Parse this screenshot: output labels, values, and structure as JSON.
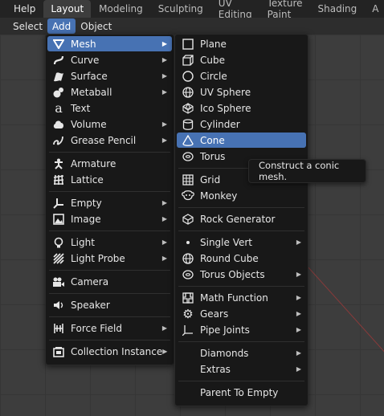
{
  "topbar": {
    "help": "Help",
    "tabs": [
      {
        "label": "Layout",
        "active": true
      },
      {
        "label": "Modeling"
      },
      {
        "label": "Sculpting"
      },
      {
        "label": "UV Editing"
      },
      {
        "label": "Texture Paint"
      },
      {
        "label": "Shading"
      },
      {
        "label": "A"
      }
    ]
  },
  "header": {
    "items": [
      {
        "label": "Select"
      },
      {
        "label": "Add",
        "active": true
      },
      {
        "label": "Object"
      }
    ]
  },
  "add_menu": {
    "items": [
      {
        "label": "Mesh",
        "icon": "mesh-icon",
        "submenu": true,
        "highlighted": true
      },
      {
        "label": "Curve",
        "icon": "curve-icon",
        "submenu": true
      },
      {
        "label": "Surface",
        "icon": "surface-icon",
        "submenu": true
      },
      {
        "label": "Metaball",
        "icon": "metaball-icon",
        "submenu": true
      },
      {
        "label": "Text",
        "icon": "text-icon"
      },
      {
        "label": "Volume",
        "icon": "volume-icon",
        "submenu": true
      },
      {
        "label": "Grease Pencil",
        "icon": "grease-pencil-icon",
        "submenu": true
      },
      {
        "label": "Armature",
        "icon": "armature-icon"
      },
      {
        "label": "Lattice",
        "icon": "lattice-icon"
      },
      {
        "label": "Empty",
        "icon": "empty-icon",
        "submenu": true
      },
      {
        "label": "Image",
        "icon": "image-icon",
        "submenu": true
      },
      {
        "label": "Light",
        "icon": "light-icon",
        "submenu": true
      },
      {
        "label": "Light Probe",
        "icon": "light-probe-icon",
        "submenu": true
      },
      {
        "label": "Camera",
        "icon": "camera-icon"
      },
      {
        "label": "Speaker",
        "icon": "speaker-icon"
      },
      {
        "label": "Force Field",
        "icon": "force-field-icon",
        "submenu": true
      },
      {
        "label": "Collection Instance",
        "icon": "collection-instance-icon",
        "submenu": true
      }
    ]
  },
  "mesh_menu": {
    "items": [
      {
        "label": "Plane",
        "icon": "plane-icon"
      },
      {
        "label": "Cube",
        "icon": "cube-icon"
      },
      {
        "label": "Circle",
        "icon": "circle-icon"
      },
      {
        "label": "UV Sphere",
        "icon": "uv-sphere-icon"
      },
      {
        "label": "Ico Sphere",
        "icon": "ico-sphere-icon"
      },
      {
        "label": "Cylinder",
        "icon": "cylinder-icon"
      },
      {
        "label": "Cone",
        "icon": "cone-icon",
        "highlighted": true
      },
      {
        "label": "Torus",
        "icon": "torus-icon"
      },
      {
        "label": "Grid",
        "icon": "grid-icon"
      },
      {
        "label": "Monkey",
        "icon": "monkey-icon"
      },
      {
        "label": "Rock Generator",
        "icon": "rock-icon"
      },
      {
        "label": "Single Vert",
        "icon": "dot-icon",
        "submenu": true
      },
      {
        "label": "Round Cube",
        "icon": "round-cube-icon"
      },
      {
        "label": "Torus Objects",
        "icon": "torus-objects-icon",
        "submenu": true
      },
      {
        "label": "Math Function",
        "icon": "math-function-icon",
        "submenu": true
      },
      {
        "label": "Gears",
        "icon": "gear-icon",
        "submenu": true
      },
      {
        "label": "Pipe Joints",
        "icon": "pipe-joints-icon",
        "submenu": true
      },
      {
        "label": "Diamonds",
        "submenu": true
      },
      {
        "label": "Extras",
        "submenu": true
      },
      {
        "label": "Parent To Empty"
      }
    ]
  },
  "tooltip": {
    "text": "Construct a conic mesh."
  },
  "colors": {
    "highlight": "#4772b3",
    "menu_bg": "#181818",
    "header_bg": "#2d2d2d"
  }
}
